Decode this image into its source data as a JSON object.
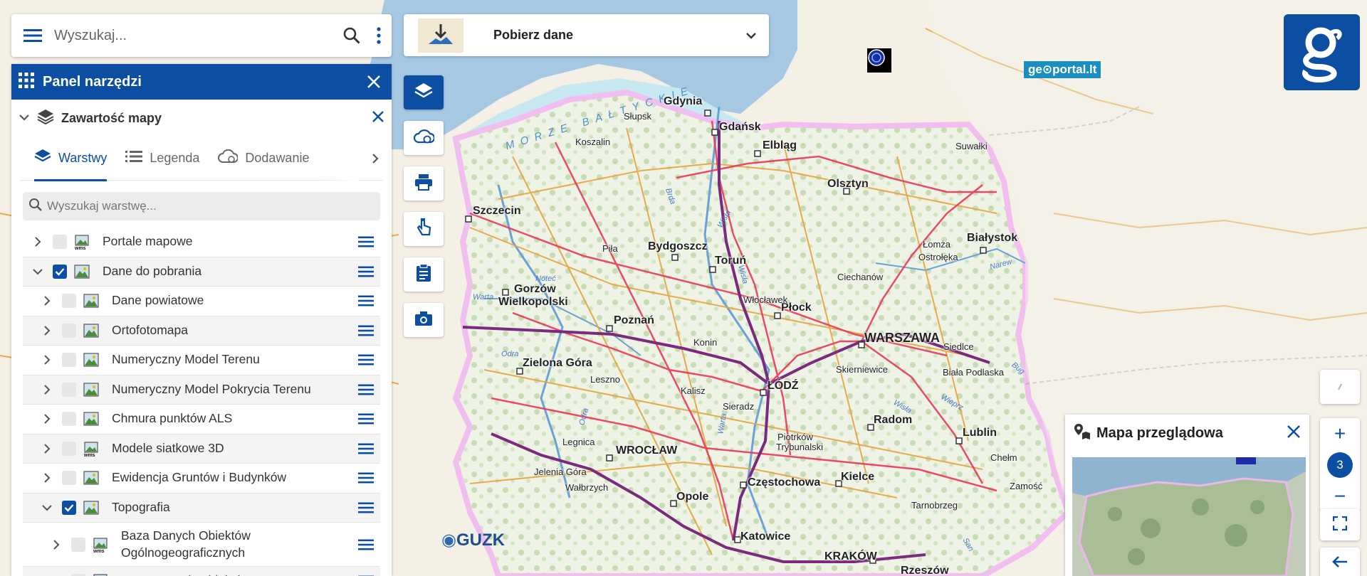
{
  "search": {
    "placeholder": "Wyszukaj..."
  },
  "panel": {
    "title": "Panel narzędzi",
    "section_title": "Zawartość mapy",
    "tabs": [
      {
        "label": "Warstwy",
        "active": true
      },
      {
        "label": "Legenda",
        "active": false
      },
      {
        "label": "Dodawanie",
        "active": false
      }
    ],
    "layer_search_placeholder": "Wyszukaj warstwę...",
    "layers": [
      {
        "name": "Portale mapowe",
        "checked": false,
        "expanded": false,
        "icon": "wms-icon",
        "level": 0
      },
      {
        "name": "Dane do pobrania",
        "checked": true,
        "expanded": true,
        "icon": "image-icon",
        "level": 0
      },
      {
        "name": "Dane powiatowe",
        "checked": false,
        "expanded": false,
        "icon": "image-icon",
        "level": 1
      },
      {
        "name": "Ortofotomapa",
        "checked": false,
        "expanded": false,
        "icon": "image-icon",
        "level": 1
      },
      {
        "name": "Numeryczny Model Terenu",
        "checked": false,
        "expanded": false,
        "icon": "image-icon",
        "level": 1
      },
      {
        "name": "Numeryczny Model Pokrycia Terenu",
        "checked": false,
        "expanded": false,
        "icon": "image-icon",
        "level": 1
      },
      {
        "name": "Chmura punktów ALS",
        "checked": false,
        "expanded": false,
        "icon": "image-icon",
        "level": 1
      },
      {
        "name": "Modele siatkowe 3D",
        "checked": false,
        "expanded": false,
        "icon": "wms-icon",
        "level": 1
      },
      {
        "name": "Ewidencja Gruntów i Budynków",
        "checked": false,
        "expanded": false,
        "icon": "image-icon",
        "level": 1
      },
      {
        "name": "Topografia",
        "checked": true,
        "expanded": true,
        "icon": "image-icon",
        "level": 1
      },
      {
        "name": "Baza Danych Obiektów Ogólnogeograficznych",
        "checked": false,
        "expanded": false,
        "icon": "wms-icon",
        "level": 2
      },
      {
        "name": "Baza Danych Obiektów",
        "checked": false,
        "expanded": false,
        "icon": "wms-icon",
        "level": 2
      }
    ]
  },
  "download": {
    "label": "Pobierz dane"
  },
  "overview": {
    "title": "Mapa przeglądowa"
  },
  "zoom": {
    "plus": "+",
    "level": "3",
    "minus": "−"
  },
  "map": {
    "sea_label": "MORZE BAŁTYCKIE",
    "geoportal_lt": "ge⊙portal.lt",
    "guzk": "GUZK",
    "cities_big": [
      {
        "name": "Gdynia"
      },
      {
        "name": "Gdańsk"
      },
      {
        "name": "Elbląg"
      },
      {
        "name": "Olsztyn"
      },
      {
        "name": "Szczecin"
      },
      {
        "name": "Bydgoszcz"
      },
      {
        "name": "Toruń"
      },
      {
        "name": "Białystok"
      },
      {
        "name": "Gorzów"
      },
      {
        "name": "Wielkopolski"
      },
      {
        "name": "Poznań"
      },
      {
        "name": "Płock"
      },
      {
        "name": "WARSZAWA"
      },
      {
        "name": "Zielona Góra"
      },
      {
        "name": "ŁÓDŹ"
      },
      {
        "name": "Radom"
      },
      {
        "name": "Lublin"
      },
      {
        "name": "WROCŁAW"
      },
      {
        "name": "Kielce"
      },
      {
        "name": "Częstochowa"
      },
      {
        "name": "Opole"
      },
      {
        "name": "Katowice"
      },
      {
        "name": "KRAKÓW"
      },
      {
        "name": "Rzeszów"
      }
    ],
    "cities_small": [
      {
        "name": "Słupsk"
      },
      {
        "name": "Koszalin"
      },
      {
        "name": "Suwałki"
      },
      {
        "name": "Piła"
      },
      {
        "name": "Łomża"
      },
      {
        "name": "Ostrołęka"
      },
      {
        "name": "Ciechanów"
      },
      {
        "name": "Włocławek"
      },
      {
        "name": "Konin"
      },
      {
        "name": "Siedlce"
      },
      {
        "name": "Skierniewice"
      },
      {
        "name": "Biała Podlaska"
      },
      {
        "name": "Leszno"
      },
      {
        "name": "Kalisz"
      },
      {
        "name": "Sieradz"
      },
      {
        "name": "Piotrków"
      },
      {
        "name": "Trybunalski"
      },
      {
        "name": "Legnica"
      },
      {
        "name": "Chełm"
      },
      {
        "name": "Jelenia Góra"
      },
      {
        "name": "Wałbrzych"
      },
      {
        "name": "Zamość"
      },
      {
        "name": "Tarnobrzeg"
      }
    ],
    "rivers": [
      {
        "name": "Wisła"
      },
      {
        "name": "Warta"
      },
      {
        "name": "Noteć"
      },
      {
        "name": "Odra"
      },
      {
        "name": "Narew"
      },
      {
        "name": "Wieprz"
      },
      {
        "name": "Bug"
      },
      {
        "name": "Warta"
      },
      {
        "name": "Odra"
      },
      {
        "name": "Wisła"
      },
      {
        "name": "Brda"
      },
      {
        "name": "San"
      },
      {
        "name": "Wisła"
      }
    ]
  },
  "colors": {
    "accent": "#0b4ea2",
    "sea": "#9fc3de",
    "land_poland": "#dfead0",
    "roads_main": "#e8395a",
    "roads_secondary": "#e8a23a",
    "motorway": "#7b2a7e"
  }
}
